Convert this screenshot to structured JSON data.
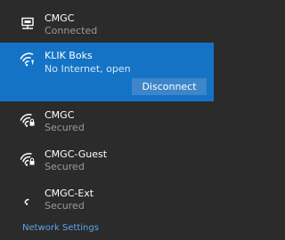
{
  "networks": [
    {
      "name": "CMGC",
      "status": "Connected",
      "icon": "ethernet-icon"
    },
    {
      "name": "KLIK Boks",
      "status": "No Internet, open",
      "icon": "wifi-unsecured-icon"
    },
    {
      "name": "CMGC",
      "status": "Secured",
      "icon": "wifi-secured-icon"
    },
    {
      "name": "CMGC-Guest",
      "status": "Secured",
      "icon": "wifi-secured-icon"
    },
    {
      "name": "CMGC-Ext",
      "status": "Secured",
      "icon": "wifi-weak-secured-icon"
    }
  ],
  "actions": {
    "disconnect_label": "Disconnect"
  },
  "footer": {
    "settings_label": "Network Settings"
  },
  "colors": {
    "panel_bg": "#2b2b2b",
    "selected_bg": "#1473c5",
    "button_bg": "#3d86c9",
    "link": "#5aa7e8",
    "secondary_text": "#9a9a9a"
  }
}
